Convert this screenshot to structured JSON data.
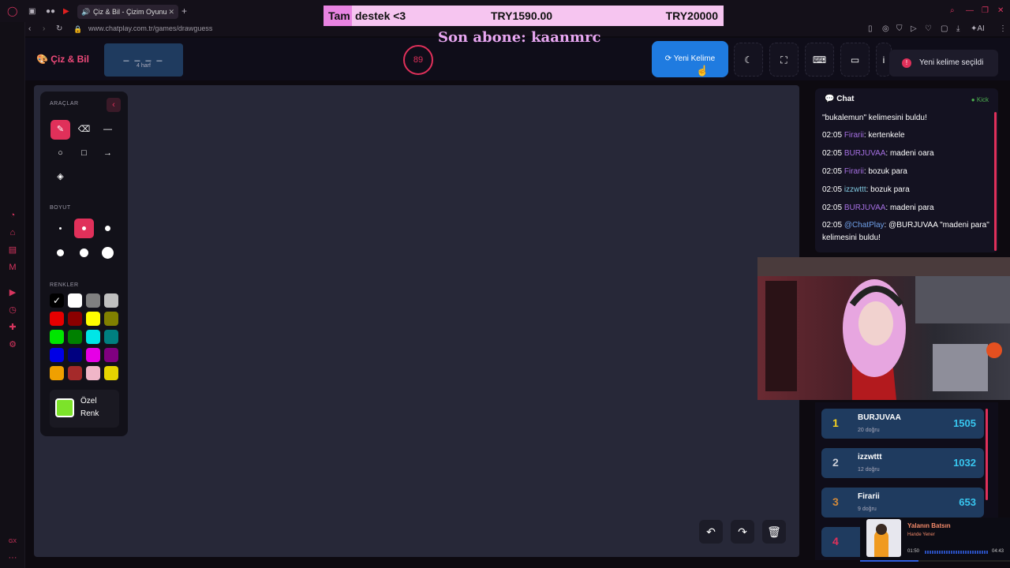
{
  "browser": {
    "tab_title": "Çiz & Bil - Çizim Oyunu",
    "url": "www.chatplay.com.tr/games/drawguess",
    "ai_label": "AI",
    "gx_label": "GX"
  },
  "donation": {
    "name": "Tam",
    "message": "destek <3",
    "amount": "TRY1590.00",
    "goal": "TRY20000"
  },
  "overlay_text": "Son abone: kaanmrc",
  "app": {
    "logo": "Çiz & Bil",
    "word_mask": "_ _ _ _",
    "word_length": "4 harf",
    "timer": "89",
    "new_word_button": "Yeni Kelime",
    "toast": "Yeni kelime seçildi"
  },
  "tools": {
    "section_tools": "ARAÇLAR",
    "section_size": "BOYUT",
    "section_colors": "RENKLER",
    "custom_color_label": "Özel Renk",
    "custom_color": "#7ce32a",
    "palette": [
      "#000000",
      "#ffffff",
      "#808080",
      "#c0c0c0",
      "#e60000",
      "#8b0000",
      "#ffff00",
      "#808000",
      "#00e600",
      "#008000",
      "#00e6e6",
      "#008080",
      "#0000e6",
      "#000080",
      "#e600e6",
      "#800080",
      "#f0a000",
      "#a52a2a",
      "#f0b6c8",
      "#e6d400"
    ]
  },
  "chat": {
    "title": "Chat",
    "platform": "Kick",
    "messages": [
      {
        "time": "",
        "user": "",
        "text": "\"bukalemun\" kelimesini buldu!"
      },
      {
        "time": "02:05",
        "user": "Firarii",
        "text": ": kertenkele"
      },
      {
        "time": "02:05",
        "user": "BURJUVAA",
        "text": ": madeni oara"
      },
      {
        "time": "02:05",
        "user": "Firarii",
        "text": ": bozuk para"
      },
      {
        "time": "02:05",
        "user": "izzwttt",
        "text": ": bozuk para"
      },
      {
        "time": "02:05",
        "user": "BURJUVAA",
        "text": ": madeni para"
      },
      {
        "time": "02:05",
        "user": "@ChatPlay",
        "text": ": @BURJUVAA \"madeni para\" kelimesini buldu!"
      }
    ]
  },
  "leaderboard": [
    {
      "rank": "1",
      "name": "BURJUVAA",
      "sub": "20 doğru",
      "score": "1505",
      "color": "#f5d020"
    },
    {
      "rank": "2",
      "name": "izzwttt",
      "sub": "12 doğru",
      "score": "1032",
      "color": "#c9cdd6"
    },
    {
      "rank": "3",
      "name": "Firarii",
      "sub": "9 doğru",
      "score": "653",
      "color": "#d28a3a"
    },
    {
      "rank": "4",
      "name": "",
      "sub": "",
      "score": "",
      "color": "#e0305a"
    }
  ],
  "music": {
    "title": "Yalanın Batsın",
    "artist": "Hande Yener",
    "elapsed": "01:50",
    "duration": "04:43",
    "progress": 0.39
  }
}
